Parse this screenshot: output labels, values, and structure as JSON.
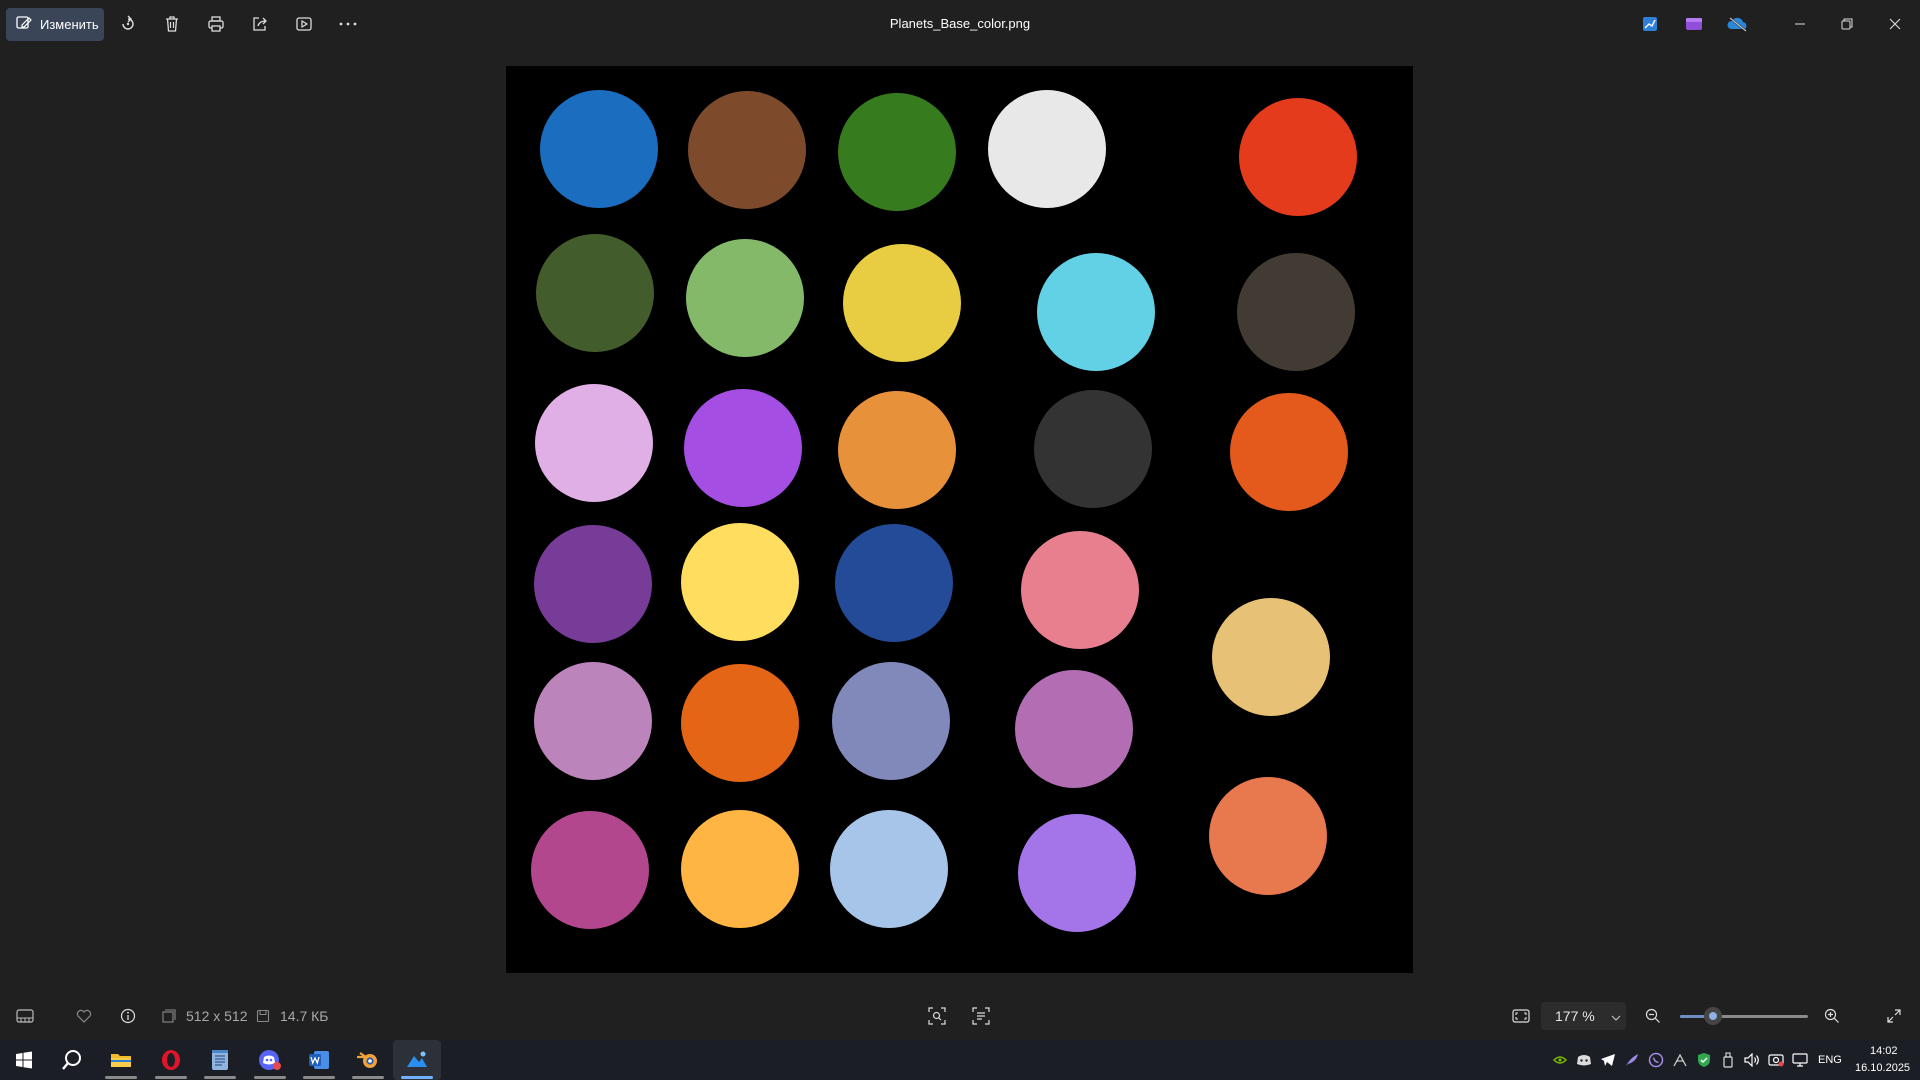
{
  "app": {
    "file_name": "Planets_Base_color.png"
  },
  "toolbar": {
    "edit_label": "Изменить",
    "icons": [
      "edit-icon",
      "rotate-icon",
      "delete-icon",
      "print-icon",
      "share-icon",
      "slideshow-icon",
      "more-icon"
    ]
  },
  "title_bar_right": {
    "icons": [
      "photo-editor-icon",
      "clipchamp-icon",
      "onedrive-icon",
      "minimize-icon",
      "restore-icon",
      "close-icon"
    ]
  },
  "image": {
    "background": "#000000",
    "circle_colors": [
      "#1a6dbf",
      "#7d4a2b",
      "#367b1e",
      "#e8e8e8",
      "#e33b1c",
      "#435c2b",
      "#84b96a",
      "#e8cd43",
      "#62d1e6",
      "#423b33",
      "#e0afe6",
      "#a54ee3",
      "#e7913b",
      "#333333",
      "#e35a1c",
      "#763c98",
      "#fedd5f",
      "#234b97",
      "#e87f8f",
      "#e7c175",
      "#bb85bb",
      "#e56516",
      "#8189bb",
      "#b26db3",
      "#e8784d",
      "#b2478e",
      "#feb544",
      "#a7c5e8",
      "#a375e8"
    ]
  },
  "bottom_bar": {
    "dimensions": "512 x 512",
    "file_size": "14.7 КБ",
    "zoom": "177 %",
    "zoom_fraction": 0.2,
    "icons": [
      "filmstrip-icon",
      "favorite-icon",
      "info-icon",
      "dimensions-icon",
      "file-size-icon",
      "visual-search-icon",
      "text-recognition-icon",
      "fit-to-window-icon",
      "zoom-out-icon",
      "zoom-in-icon",
      "fullscreen-icon"
    ]
  },
  "taskbar": {
    "apps": [
      "windows-start",
      "search",
      "file-explorer",
      "opera",
      "notepad",
      "discord",
      "word",
      "blender",
      "photos"
    ],
    "language": "ENG",
    "time": "14:02",
    "date": "16.10.2025"
  }
}
